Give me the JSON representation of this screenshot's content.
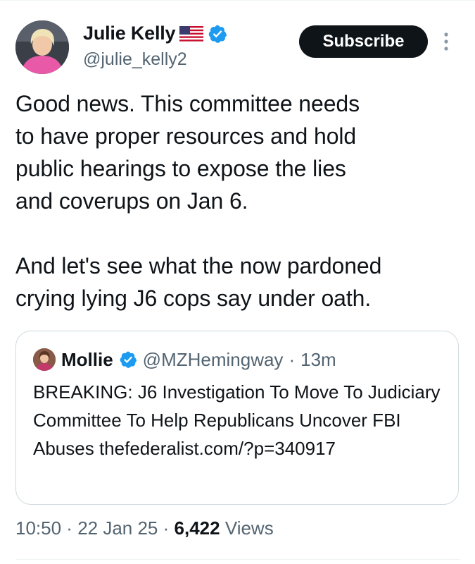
{
  "author": {
    "name": "Julie Kelly",
    "flag": "🇺🇸",
    "handle": "@julie_kelly2",
    "verified_color": "#1d9bf0"
  },
  "subscribe_label": "Subscribe",
  "tweet": {
    "text": "Good news. This committee needs\nto have proper resources and hold\npublic hearings to expose the lies\nand coverups on Jan 6.\n\nAnd let's see what the now pardoned\ncrying lying J6 cops say under oath."
  },
  "quote": {
    "name": "Mollie",
    "handle": "@MZHemingway",
    "separator": " · ",
    "time": "13m",
    "text": "BREAKING: J6 Investigation To Move To Judiciary Committee To Help Republicans Uncover FBI Abuses thefederalist.com/?p=340917"
  },
  "meta": {
    "time": "10:50",
    "sep1": " · ",
    "date": "22 Jan 25",
    "sep2": " · ",
    "views": "6,422",
    "views_label": " Views"
  },
  "colors": {
    "text": "#0f1419",
    "secondary": "#536471",
    "border": "#cfd9de",
    "accent": "#1d9bf0"
  },
  "icons": {
    "flag": "us-flag-icon",
    "verified": "verified-badge-icon",
    "more": "vertical-dots-icon"
  }
}
